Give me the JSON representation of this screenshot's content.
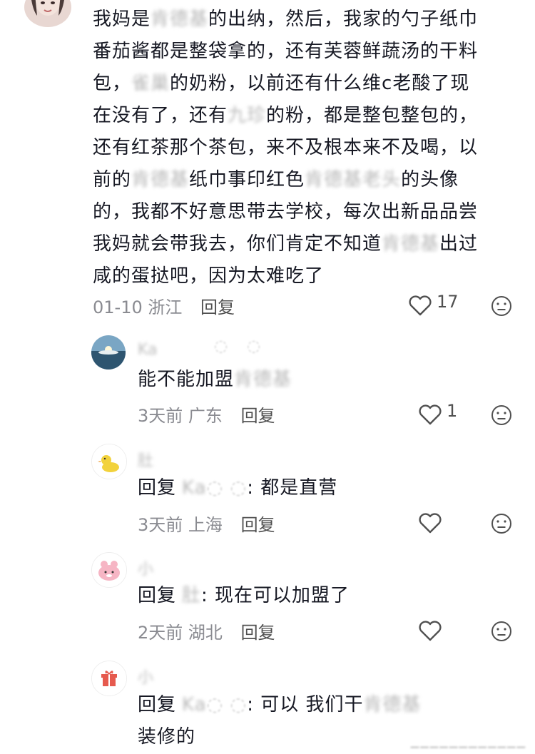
{
  "comments": [
    {
      "text": "我妈是肯德基的出纳，然后，我家的勺子纸巾番茄酱都是整袋拿的，还有芙蓉鲜蔬汤的干料包，雀巢的奶粉，以前还有什么维c老酸了现在没有了，还有九珍的粉，都是整包整包的，还有红茶那个茶包，来不及根本来不及喝，以前的肯德基纸巾事印红色肯德基老头的头像的，我都不好意思带去学校，每次出新品品尝我妈就会带我去，你们肯定不知道肯德基出过咸的蛋挞吧，因为太难吃了",
      "lines": [
        [
          "我妈是",
          "肯德基",
          "的出纳，然后，我家的勺子纸巾"
        ],
        [
          "番茄酱都是整袋拿的，还有芙蓉鲜蔬汤的干料"
        ],
        [
          "包，",
          "雀巢",
          "的奶粉，以前还有什么维c老酸了现"
        ],
        [
          "在没有了，还有",
          "九珍",
          "的粉，都是整包整包的，"
        ],
        [
          "还有红茶那个茶包，来不及根本来不及喝，以"
        ],
        [
          "前的",
          "肯德基",
          "纸巾事印红色",
          "肯德基老头",
          "的头像"
        ],
        [
          "的，我都不好意思带去学校，每次出新品品尝"
        ],
        [
          "我妈就会带我去，你们肯定不知道",
          "肯德基",
          "出过"
        ],
        [
          "咸的蛋挞吧，因为太难吃了"
        ]
      ],
      "date": "01-10",
      "location": "浙江",
      "reply_label": "回复",
      "likes": "17"
    },
    {
      "author": "Ka",
      "text_plain": "能不能加盟",
      "text_blur": "肯德基",
      "date": "3天前",
      "location": "广东",
      "reply_label": "回复",
      "likes": "1"
    },
    {
      "author": "肚",
      "reply_prefix": "回复",
      "reply_to": "Ka",
      "text": ": 都是直营",
      "date": "3天前",
      "location": "上海",
      "reply_label": "回复"
    },
    {
      "author": "小",
      "reply_prefix": "回复",
      "reply_to": "肚",
      "text": ": 现在可以加盟了",
      "date": "2天前",
      "location": "湖北",
      "reply_label": "回复"
    },
    {
      "author": "小",
      "reply_prefix": "回复",
      "reply_to": "Ka",
      "text_line1": ": 可以 我们干",
      "text_blur": "肯德基",
      "text_line2": "装修的"
    }
  ],
  "colors": {
    "text": "#161823",
    "meta": "#8a8b91",
    "blurred": "#b8b8b8",
    "icon": "#505050"
  },
  "icons": {
    "like": "heart-outline-icon",
    "dislike": "meh-face-icon",
    "avatars": [
      "woman-photo-avatar",
      "ocean-photo-avatar",
      "duck-avatar",
      "pink-cat-avatar",
      "gift-avatar"
    ]
  }
}
